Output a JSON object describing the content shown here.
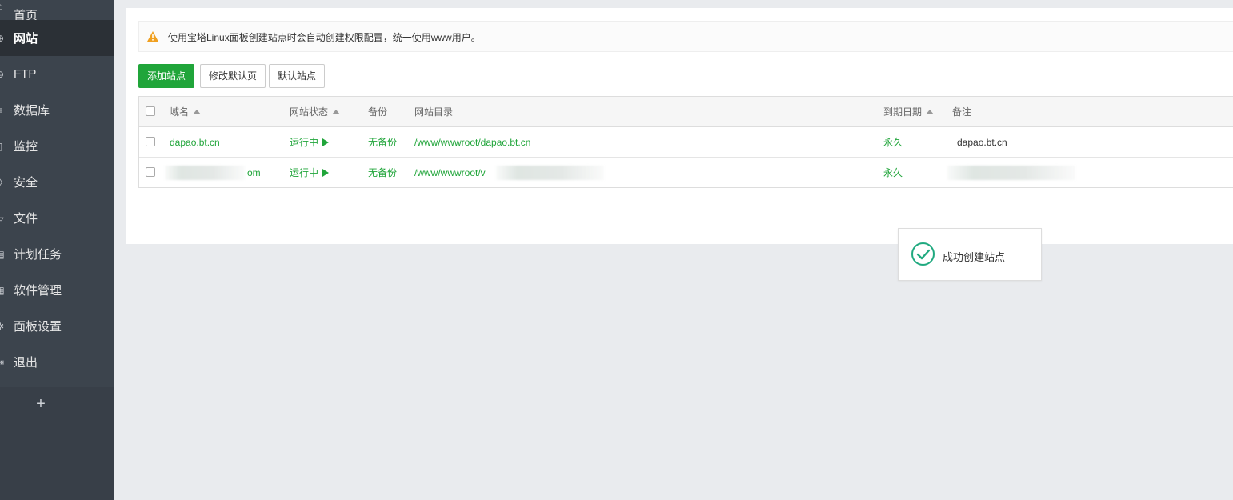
{
  "sidebar": {
    "items": [
      {
        "label": "首页",
        "icon": "home-icon"
      },
      {
        "label": "网站",
        "icon": "globe-icon",
        "active": true
      },
      {
        "label": "FTP",
        "icon": "ftp-icon"
      },
      {
        "label": "数据库",
        "icon": "database-icon"
      },
      {
        "label": "监控",
        "icon": "monitor-icon"
      },
      {
        "label": "安全",
        "icon": "shield-icon"
      },
      {
        "label": "文件",
        "icon": "folder-icon"
      },
      {
        "label": "计划任务",
        "icon": "calendar-icon"
      },
      {
        "label": "软件管理",
        "icon": "apps-icon"
      },
      {
        "label": "面板设置",
        "icon": "gear-icon"
      },
      {
        "label": "退出",
        "icon": "logout-icon"
      }
    ],
    "add_label": "+"
  },
  "notice": {
    "text": "使用宝塔Linux面板创建站点时会自动创建权限配置，统一使用www用户。"
  },
  "toolbar": {
    "add_site_label": "添加站点",
    "edit_default_page_label": "修改默认页",
    "default_site_label": "默认站点"
  },
  "table": {
    "headers": {
      "domain": "域名",
      "status": "网站状态",
      "backup": "备份",
      "path": "网站目录",
      "expire": "到期日期",
      "remark": "备注"
    },
    "rows": [
      {
        "domain": "dapao.bt.cn",
        "status": "运行中",
        "backup": "无备份",
        "path": "/www/wwwroot/dapao.bt.cn",
        "expire": "永久",
        "remark": "dapao.bt.cn"
      },
      {
        "domain": "om",
        "status": "运行中",
        "backup": "无备份",
        "path": "/www/wwwroot/v",
        "expire": "永久",
        "remark": ""
      }
    ]
  },
  "toast": {
    "text": "成功创建站点"
  },
  "colors": {
    "accent": "#20a53a",
    "sidebar_bg": "#3c444d",
    "warning": "#f0a020"
  }
}
